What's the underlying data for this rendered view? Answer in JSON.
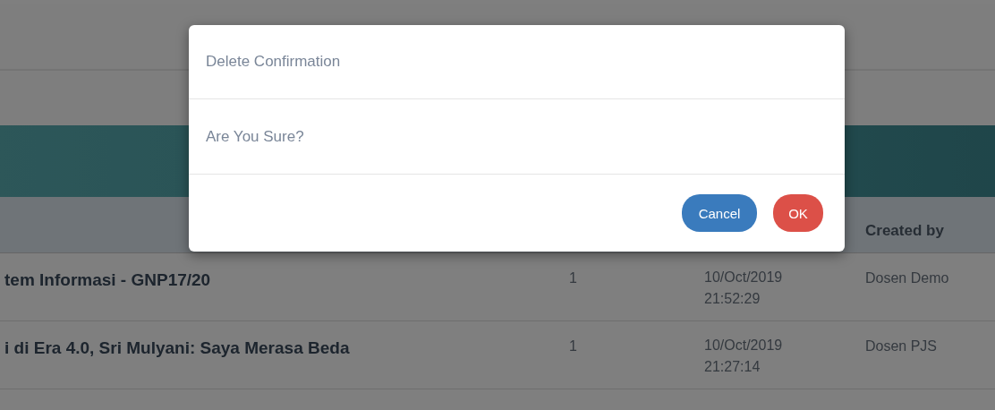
{
  "table": {
    "header": {
      "column_5": "Created by"
    },
    "rows": [
      {
        "title": "tem Informasi - GNP17/20",
        "column_2": "1",
        "date": "10/Oct/2019",
        "time": "21:52:29",
        "created_by": "Dosen Demo"
      },
      {
        "title": "i di Era 4.0, Sri Mulyani: Saya Merasa Beda",
        "column_2": "1",
        "date": "10/Oct/2019",
        "time": "21:27:14",
        "created_by": "Dosen PJS"
      }
    ]
  },
  "modal": {
    "title": "Delete Confirmation",
    "message": "Are You Sure?",
    "buttons": [
      {
        "label": "Cancel",
        "kind": "primary"
      },
      {
        "label": "OK",
        "kind": "danger"
      }
    ]
  }
}
